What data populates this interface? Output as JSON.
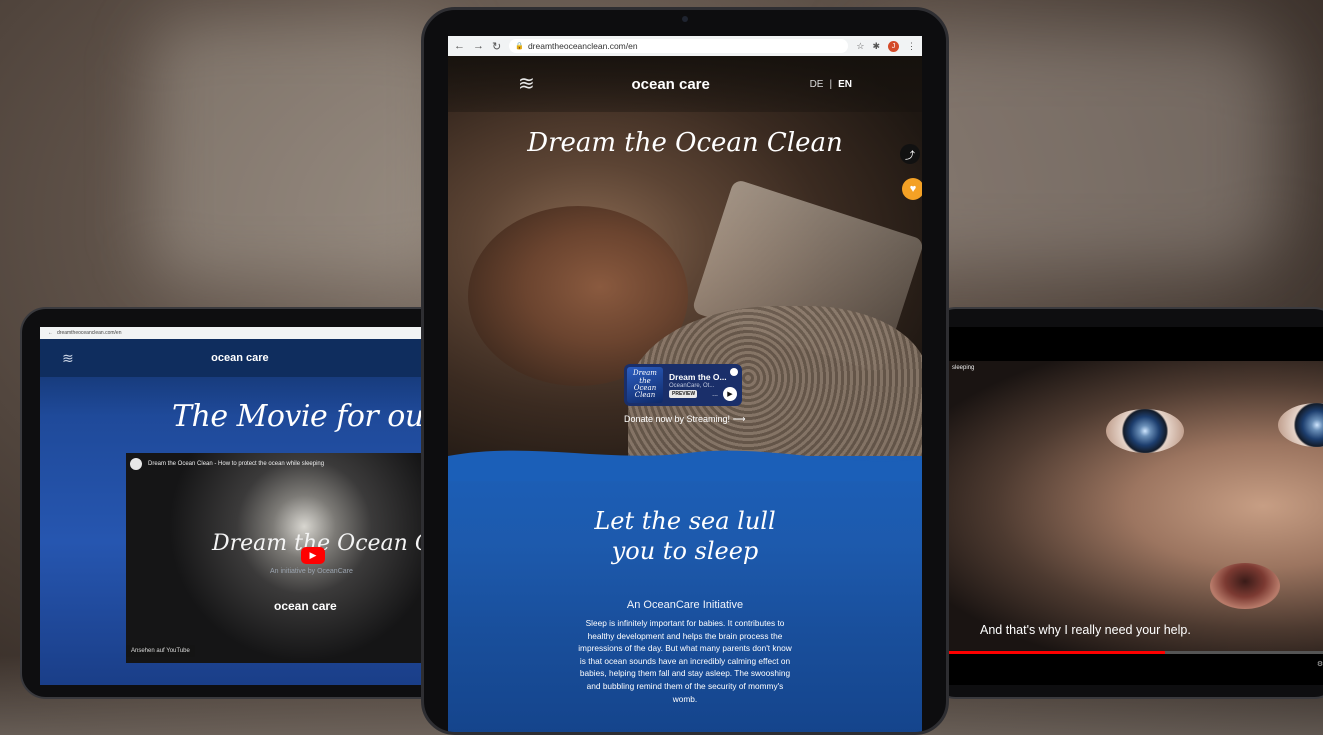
{
  "left_tablet": {
    "url": "dreamtheoceanclean.com/en",
    "logo": "ocean care",
    "title": "The Movie for our Song",
    "video": {
      "channel_title": "Dream the Ocean Clean - How to protect the ocean while sleeping",
      "overlay_title": "Dream the Ocean Clean",
      "initiative": "An initiative by OceanCare",
      "logo": "ocean care",
      "watch_on": "Ansehen auf",
      "watch_on_brand": "YouTube"
    }
  },
  "center_tablet": {
    "url": "dreamtheoceanclean.com/en",
    "logo": "ocean care",
    "lang": {
      "de": "DE",
      "separator": "|",
      "en": "EN"
    },
    "hero_title": "Dream the Ocean Clean",
    "player": {
      "cover_text": "Dream the Ocean Clean",
      "title": "Dream the O...",
      "subtitle": "OceanCare, Ot...",
      "preview_label": "PREVIEW",
      "more": "..."
    },
    "stream_link": "Donate now by Streaming!",
    "ocean_title_line1": "Let the sea lull",
    "ocean_title_line2": "you to sleep",
    "initiative": "An OceanCare Initiative",
    "body": "Sleep is infinitely important for babies. It contributes to healthy development and helps the brain process the impressions of the day. But what many parents don't know is that ocean sounds have an incredibly calming effect on babies, helping them fall and stay asleep. The swooshing and bubbling remind them of the security of mommy's womb."
  },
  "right_tablet": {
    "video_title_fragment": "sleeping",
    "caption": "And that's why I really need your help.",
    "progress": 0.55
  },
  "colors": {
    "ocean_blue": "#1b5fb8",
    "navy": "#0f2d5e",
    "donate_orange": "#f4a125",
    "youtube_red": "#ff0000"
  }
}
